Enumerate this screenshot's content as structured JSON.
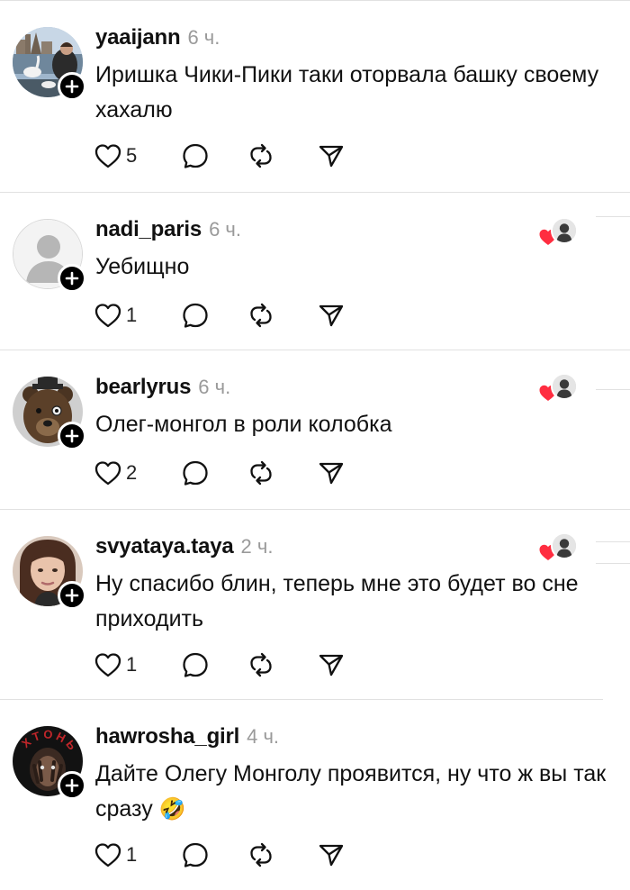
{
  "posts": [
    {
      "username": "yaaijann",
      "time": "6 ч.",
      "text": "Иришка Чики-Пики таки оторвала башку своему хахалю",
      "likes": "5",
      "liked_by_author": false,
      "avatar": "swan-lake-photo"
    },
    {
      "username": "nadi_paris",
      "time": "6 ч.",
      "text": "Уебищно",
      "likes": "1",
      "liked_by_author": true,
      "avatar": "default-user-silhouette"
    },
    {
      "username": "bearlyrus",
      "time": "6 ч.",
      "text": "Олег-монгол в роли колобка",
      "likes": "2",
      "liked_by_author": true,
      "avatar": "bear-photo"
    },
    {
      "username": "svyataya.taya",
      "time": "2 ч.",
      "text": "Ну спасибо блин, теперь мне это будет во сне приходить",
      "likes": "1",
      "liked_by_author": true,
      "avatar": "woman-portrait"
    },
    {
      "username": "hawrosha_girl",
      "time": "4 ч.",
      "text": "Дайте Олегу Монголу проявится, ну что ж вы так сразу",
      "emoji": "🤣",
      "likes": "1",
      "liked_by_author": false,
      "avatar": "dark-portrait-xtonb"
    }
  ],
  "icons": {
    "like": "heart-outline-icon",
    "reply": "speech-bubble-icon",
    "repost": "repost-arrows-icon",
    "share": "paper-plane-icon",
    "follow": "plus-icon",
    "author_like": "red-heart-icon"
  },
  "colors": {
    "heart_red": "#ff2d40",
    "time_gray": "#9a9a9a",
    "divider": "#e1e1e1"
  },
  "avatar_text": {
    "hawrosha_girl": "ХТОНЬ"
  }
}
